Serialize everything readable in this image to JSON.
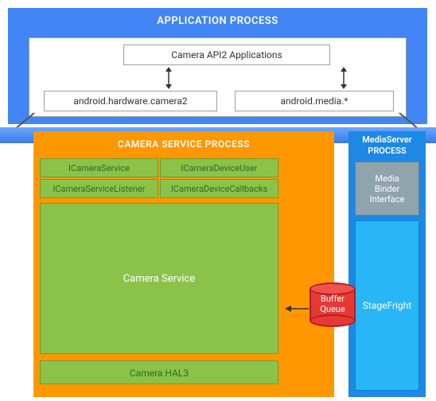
{
  "app_process": {
    "title": "APPLICATION PROCESS",
    "api2": "Camera API2 Applications",
    "hw_camera2": "android.hardware.camera2",
    "media": "android.media.*"
  },
  "camera_service_process": {
    "title": "CAMERA SERVICE PROCESS",
    "cells": {
      "icamera_service": "ICameraService",
      "icamera_device_user": "ICameraDeviceUser",
      "icamera_service_listener": "ICameraServiceListener",
      "icamera_device_callbacks": "ICameraDeviceCallbacks"
    },
    "camera_service": "Camera Service",
    "hal3": "Camera HAL3"
  },
  "mediaserver_process": {
    "title": "MediaServer\nPROCESS",
    "media_binder_interface": "Media\nBinder\nInterface",
    "stagefright": "StageFright"
  },
  "buffer_queue": "Buffer\nQueue"
}
